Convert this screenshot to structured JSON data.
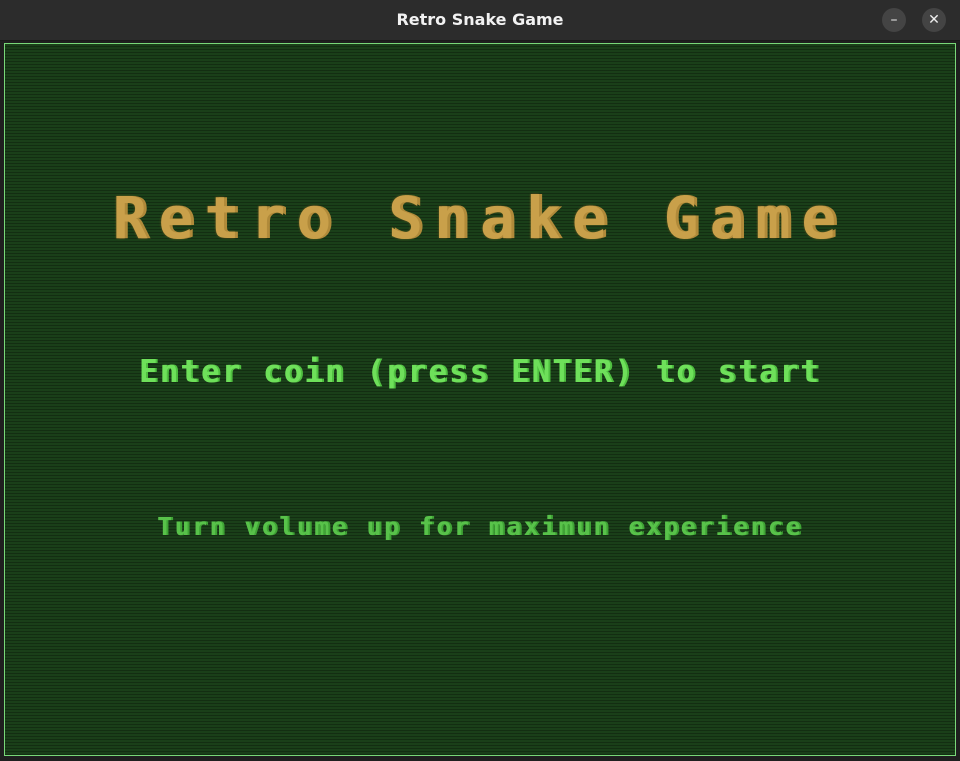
{
  "window": {
    "title": "Retro Snake Game",
    "minimize_icon": "–",
    "close_icon": "✕"
  },
  "screen": {
    "game_title": "Retro Snake Game",
    "start_prompt": "Enter coin (press ENTER) to start",
    "volume_hint": "Turn volume up for maximun experience"
  },
  "colors": {
    "title_text": "#c9a04a",
    "prompt_text": "#6ee05a",
    "hint_text": "#58c24a",
    "screen_bg": "#1a3f19",
    "screen_border": "#79d879"
  }
}
